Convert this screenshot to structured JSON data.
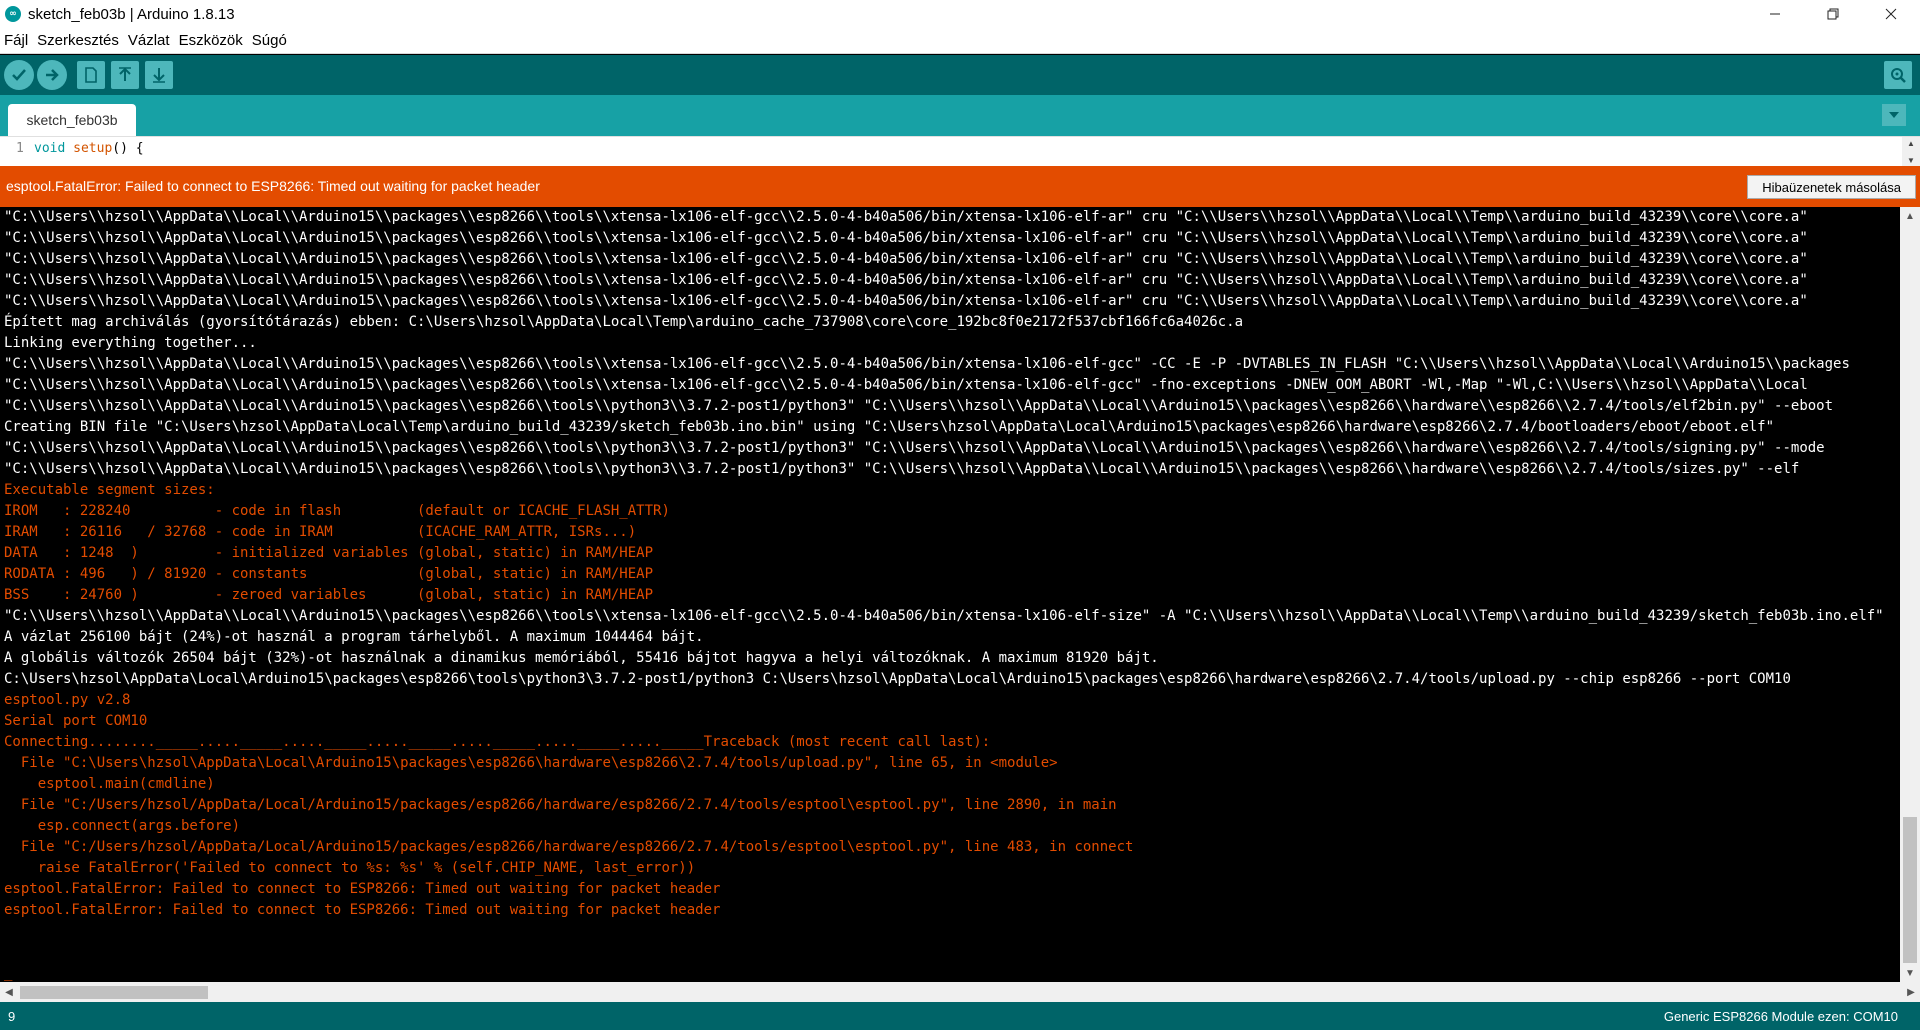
{
  "window": {
    "title": "sketch_feb03b | Arduino 1.8.13",
    "icon": "arduino-logo",
    "controls": [
      "minimize",
      "maximize",
      "close"
    ]
  },
  "menu": [
    "Fájl",
    "Szerkesztés",
    "Vázlat",
    "Eszközök",
    "Súgó"
  ],
  "toolbar": {
    "buttons": [
      "verify-icon",
      "upload-icon",
      "new-icon",
      "open-icon",
      "save-icon"
    ],
    "right_button": "serial-monitor-icon",
    "color": "#006468"
  },
  "tabs": [
    {
      "label": "sketch_feb03b"
    }
  ],
  "editor": {
    "line_number": "1",
    "code_keyword": "void",
    "code_function": "setup",
    "code_rest": "() {"
  },
  "error": {
    "message": "esptool.FatalError: Failed to connect to ESP8266: Timed out waiting for packet header",
    "copy_button": "Hibaüzenetek másolása",
    "color": "#e34c00"
  },
  "console": [
    {
      "c": "white",
      "t": "\"C:\\\\Users\\\\hzsol\\\\AppData\\\\Local\\\\Arduino15\\\\packages\\\\esp8266\\\\tools\\\\xtensa-lx106-elf-gcc\\\\2.5.0-4-b40a506/bin/xtensa-lx106-elf-ar\" cru \"C:\\\\Users\\\\hzsol\\\\AppData\\\\Local\\\\Temp\\\\arduino_build_43239\\\\core\\\\core.a\""
    },
    {
      "c": "white",
      "t": "\"C:\\\\Users\\\\hzsol\\\\AppData\\\\Local\\\\Arduino15\\\\packages\\\\esp8266\\\\tools\\\\xtensa-lx106-elf-gcc\\\\2.5.0-4-b40a506/bin/xtensa-lx106-elf-ar\" cru \"C:\\\\Users\\\\hzsol\\\\AppData\\\\Local\\\\Temp\\\\arduino_build_43239\\\\core\\\\core.a\""
    },
    {
      "c": "white",
      "t": "\"C:\\\\Users\\\\hzsol\\\\AppData\\\\Local\\\\Arduino15\\\\packages\\\\esp8266\\\\tools\\\\xtensa-lx106-elf-gcc\\\\2.5.0-4-b40a506/bin/xtensa-lx106-elf-ar\" cru \"C:\\\\Users\\\\hzsol\\\\AppData\\\\Local\\\\Temp\\\\arduino_build_43239\\\\core\\\\core.a\""
    },
    {
      "c": "white",
      "t": "\"C:\\\\Users\\\\hzsol\\\\AppData\\\\Local\\\\Arduino15\\\\packages\\\\esp8266\\\\tools\\\\xtensa-lx106-elf-gcc\\\\2.5.0-4-b40a506/bin/xtensa-lx106-elf-ar\" cru \"C:\\\\Users\\\\hzsol\\\\AppData\\\\Local\\\\Temp\\\\arduino_build_43239\\\\core\\\\core.a\""
    },
    {
      "c": "white",
      "t": "\"C:\\\\Users\\\\hzsol\\\\AppData\\\\Local\\\\Arduino15\\\\packages\\\\esp8266\\\\tools\\\\xtensa-lx106-elf-gcc\\\\2.5.0-4-b40a506/bin/xtensa-lx106-elf-ar\" cru \"C:\\\\Users\\\\hzsol\\\\AppData\\\\Local\\\\Temp\\\\arduino_build_43239\\\\core\\\\core.a\""
    },
    {
      "c": "white",
      "t": "Épített mag archiválás (gyorsítótárazás) ebben: C:\\Users\\hzsol\\AppData\\Local\\Temp\\arduino_cache_737908\\core\\core_192bc8f0e2172f537cbf166fc6a4026c.a"
    },
    {
      "c": "white",
      "t": "Linking everything together..."
    },
    {
      "c": "white",
      "t": "\"C:\\\\Users\\\\hzsol\\\\AppData\\\\Local\\\\Arduino15\\\\packages\\\\esp8266\\\\tools\\\\xtensa-lx106-elf-gcc\\\\2.5.0-4-b40a506/bin/xtensa-lx106-elf-gcc\" -CC -E -P -DVTABLES_IN_FLASH \"C:\\\\Users\\\\hzsol\\\\AppData\\\\Local\\\\Arduino15\\\\packages"
    },
    {
      "c": "white",
      "t": "\"C:\\\\Users\\\\hzsol\\\\AppData\\\\Local\\\\Arduino15\\\\packages\\\\esp8266\\\\tools\\\\xtensa-lx106-elf-gcc\\\\2.5.0-4-b40a506/bin/xtensa-lx106-elf-gcc\" -fno-exceptions -DNEW_OOM_ABORT -Wl,-Map \"-Wl,C:\\\\Users\\\\hzsol\\\\AppData\\\\Local"
    },
    {
      "c": "white",
      "t": "\"C:\\\\Users\\\\hzsol\\\\AppData\\\\Local\\\\Arduino15\\\\packages\\\\esp8266\\\\tools\\\\python3\\\\3.7.2-post1/python3\" \"C:\\\\Users\\\\hzsol\\\\AppData\\\\Local\\\\Arduino15\\\\packages\\\\esp8266\\\\hardware\\\\esp8266\\\\2.7.4/tools/elf2bin.py\" --eboot"
    },
    {
      "c": "white",
      "t": "Creating BIN file \"C:\\Users\\hzsol\\AppData\\Local\\Temp\\arduino_build_43239/sketch_feb03b.ino.bin\" using \"C:\\Users\\hzsol\\AppData\\Local\\Arduino15\\packages\\esp8266\\hardware\\esp8266\\2.7.4/bootloaders/eboot/eboot.elf\""
    },
    {
      "c": "white",
      "t": "\"C:\\\\Users\\\\hzsol\\\\AppData\\\\Local\\\\Arduino15\\\\packages\\\\esp8266\\\\tools\\\\python3\\\\3.7.2-post1/python3\" \"C:\\\\Users\\\\hzsol\\\\AppData\\\\Local\\\\Arduino15\\\\packages\\\\esp8266\\\\hardware\\\\esp8266\\\\2.7.4/tools/signing.py\" --mode"
    },
    {
      "c": "white",
      "t": "\"C:\\\\Users\\\\hzsol\\\\AppData\\\\Local\\\\Arduino15\\\\packages\\\\esp8266\\\\tools\\\\python3\\\\3.7.2-post1/python3\" \"C:\\\\Users\\\\hzsol\\\\AppData\\\\Local\\\\Arduino15\\\\packages\\\\esp8266\\\\hardware\\\\esp8266\\\\2.7.4/tools/sizes.py\" --elf"
    },
    {
      "c": "orange",
      "t": "Executable segment sizes:"
    },
    {
      "c": "orange",
      "t": "IROM   : 228240          - code in flash         (default or ICACHE_FLASH_ATTR)"
    },
    {
      "c": "orange",
      "t": "IRAM   : 26116   / 32768 - code in IRAM          (ICACHE_RAM_ATTR, ISRs...)"
    },
    {
      "c": "orange",
      "t": "DATA   : 1248  )         - initialized variables (global, static) in RAM/HEAP"
    },
    {
      "c": "orange",
      "t": "RODATA : 496   ) / 81920 - constants             (global, static) in RAM/HEAP"
    },
    {
      "c": "orange",
      "t": "BSS    : 24760 )         - zeroed variables      (global, static) in RAM/HEAP"
    },
    {
      "c": "white",
      "t": "\"C:\\\\Users\\\\hzsol\\\\AppData\\\\Local\\\\Arduino15\\\\packages\\\\esp8266\\\\tools\\\\xtensa-lx106-elf-gcc\\\\2.5.0-4-b40a506/bin/xtensa-lx106-elf-size\" -A \"C:\\\\Users\\\\hzsol\\\\AppData\\\\Local\\\\Temp\\\\arduino_build_43239/sketch_feb03b.ino.elf\""
    },
    {
      "c": "white",
      "t": "A vázlat 256100 bájt (24%)-ot használ a program tárhelyből. A maximum 1044464 bájt."
    },
    {
      "c": "white",
      "t": "A globális változók 26504 bájt (32%)-ot használnak a dinamikus memóriából, 55416 bájtot hagyva a helyi változóknak. A maximum 81920 bájt."
    },
    {
      "c": "white",
      "t": "C:\\Users\\hzsol\\AppData\\Local\\Arduino15\\packages\\esp8266\\tools\\python3\\3.7.2-post1/python3 C:\\Users\\hzsol\\AppData\\Local\\Arduino15\\packages\\esp8266\\hardware\\esp8266\\2.7.4/tools/upload.py --chip esp8266 --port COM10"
    },
    {
      "c": "orange",
      "t": "esptool.py v2.8"
    },
    {
      "c": "orange",
      "t": "Serial port COM10"
    },
    {
      "c": "orange",
      "t": "Connecting........_____....._____....._____....._____....._____....._____....._____Traceback (most recent call last):"
    },
    {
      "c": "orange",
      "t": "  File \"C:\\Users\\hzsol\\AppData\\Local\\Arduino15\\packages\\esp8266\\hardware\\esp8266\\2.7.4/tools/upload.py\", line 65, in <module>"
    },
    {
      "c": "orange",
      "t": "    esptool.main(cmdline)"
    },
    {
      "c": "orange",
      "t": "  File \"C:/Users/hzsol/AppData/Local/Arduino15/packages/esp8266/hardware/esp8266/2.7.4/tools/esptool\\esptool.py\", line 2890, in main"
    },
    {
      "c": "orange",
      "t": "    esp.connect(args.before)"
    },
    {
      "c": "orange",
      "t": "  File \"C:/Users/hzsol/AppData/Local/Arduino15/packages/esp8266/hardware/esp8266/2.7.4/tools/esptool\\esptool.py\", line 483, in connect"
    },
    {
      "c": "orange",
      "t": "    raise FatalError('Failed to connect to %s: %s' % (self.CHIP_NAME, last_error))"
    },
    {
      "c": "orange",
      "t": "esptool.FatalError: Failed to connect to ESP8266: Timed out waiting for packet header"
    },
    {
      "c": "orange",
      "t": "esptool.FatalError: Failed to connect to ESP8266: Timed out waiting for packet header"
    },
    {
      "c": "white",
      "t": ""
    },
    {
      "c": "white",
      "t": ""
    },
    {
      "c": "orange",
      "t": "_"
    }
  ],
  "status": {
    "line": "9",
    "board": "Generic ESP8266 Module ezen: COM10"
  }
}
